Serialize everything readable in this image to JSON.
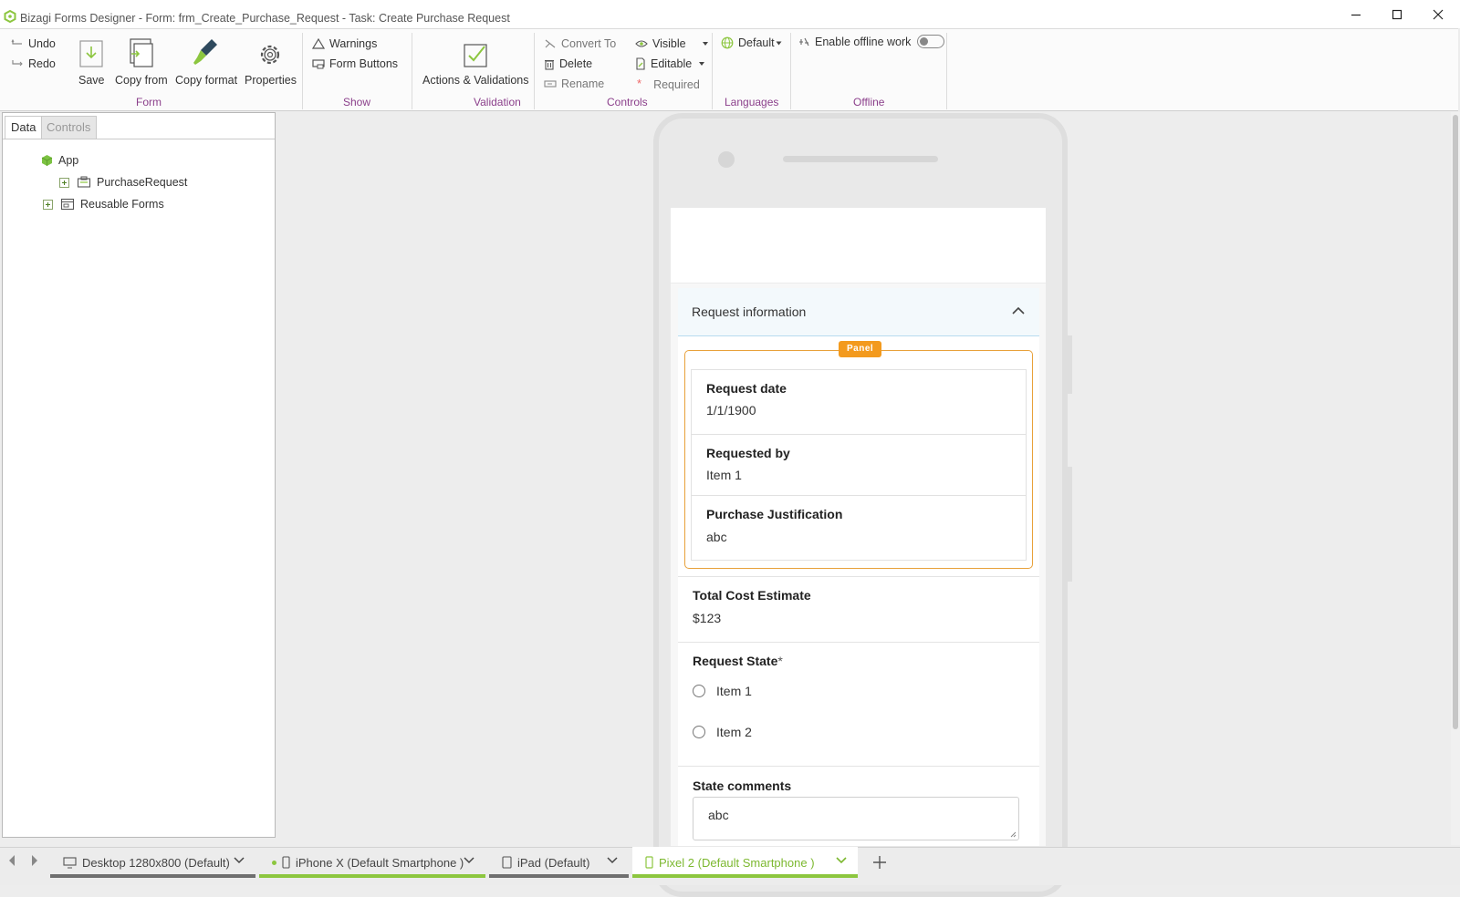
{
  "window": {
    "title": "Bizagi Forms Designer  - Form: frm_Create_Purchase_Request - Task:  Create Purchase Request"
  },
  "ribbon": {
    "undo": "Undo",
    "redo": "Redo",
    "save": "Save",
    "copy_from": "Copy from",
    "copy_format": "Copy format",
    "properties": "Properties",
    "warnings": "Warnings",
    "form_buttons": "Form Buttons",
    "actions_validations": "Actions & Validations",
    "convert_to": "Convert To",
    "delete": "Delete",
    "rename": "Rename",
    "visible": "Visible",
    "editable": "Editable",
    "required": "Required",
    "language_default": "Default",
    "offline_toggle_label": "Enable offline work",
    "offline_enabled": false,
    "groups": {
      "form": "Form",
      "show": "Show",
      "validation": "Validation",
      "controls": "Controls",
      "languages": "Languages",
      "offline": "Offline"
    }
  },
  "left_panel": {
    "tabs": {
      "data": "Data",
      "controls": "Controls"
    },
    "active_tab": "Data",
    "tree": {
      "root": "App",
      "child": "PurchaseRequest",
      "reusable": "Reusable Forms"
    }
  },
  "form": {
    "section_title": "Request information",
    "panel_badge": "Panel",
    "fields": {
      "request_date": {
        "label": "Request date",
        "value": "1/1/1900"
      },
      "requested_by": {
        "label": "Requested by",
        "value": "Item 1"
      },
      "justification": {
        "label": "Purchase Justification",
        "value": "abc"
      },
      "total_cost": {
        "label": "Total Cost Estimate",
        "value": "$123"
      },
      "request_state": {
        "label": "Request State",
        "required_mark": "*",
        "options": [
          "Item 1",
          "Item 2"
        ]
      },
      "state_comments": {
        "label": "State comments",
        "value": "abc"
      }
    }
  },
  "device_tabs": [
    {
      "label": "Desktop 1280x800 (Default)"
    },
    {
      "label": "iPhone X (Default Smartphone )"
    },
    {
      "label": "iPad (Default)"
    },
    {
      "label": "Pixel 2 (Default Smartphone )"
    }
  ],
  "active_device": "Pixel 2 (Default Smartphone )",
  "colors": {
    "accent_green": "#8cc63f",
    "group_label": "#8b3f8b",
    "panel_orange": "#f39a1e",
    "tab_bar_gray": "#6e6e6e"
  }
}
